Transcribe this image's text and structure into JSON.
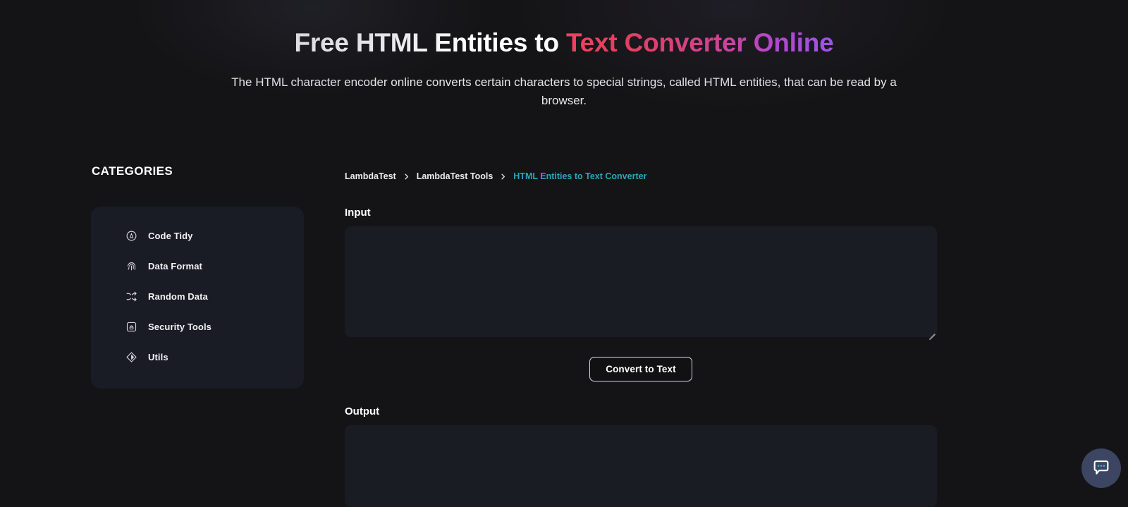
{
  "hero": {
    "title_plain": "Free HTML Entities to ",
    "title_gradient": "Text Converter Online",
    "subtitle": "The HTML character encoder online converts certain characters to special strings, called HTML entities, that can be read by a browser.",
    "gradient_from": "#f8415f",
    "gradient_to": "#a855f7"
  },
  "sidebar": {
    "heading": "CATEGORIES",
    "items": [
      {
        "label": "Code Tidy",
        "icon": "code-tidy-icon"
      },
      {
        "label": "Data Format",
        "icon": "fingerprint-icon"
      },
      {
        "label": "Random Data",
        "icon": "shuffle-icon"
      },
      {
        "label": "Security Tools",
        "icon": "lock-box-icon"
      },
      {
        "label": "Utils",
        "icon": "diamond-compass-icon"
      }
    ]
  },
  "breadcrumb": {
    "items": [
      {
        "label": "LambdaTest",
        "active": false
      },
      {
        "label": "LambdaTest Tools",
        "active": false
      },
      {
        "label": "HTML Entities to Text Converter",
        "active": true
      }
    ],
    "separator": "chevron-right-icon",
    "active_color": "#2fa3bd"
  },
  "main": {
    "input_label": "Input",
    "input_value": "",
    "input_placeholder": "",
    "convert_button": "Convert to Text",
    "output_label": "Output",
    "output_value": "",
    "output_placeholder": ""
  },
  "widgets": {
    "chat_icon": "chat-bubble-icon",
    "chat_bg": "#3c4663",
    "chat_dot_color": "#2bb2d6"
  }
}
